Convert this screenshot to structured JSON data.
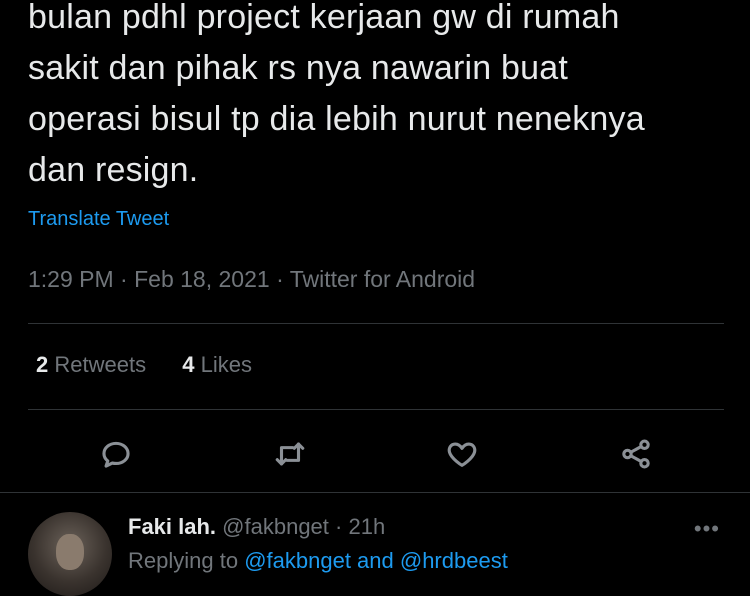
{
  "tweet": {
    "lines": [
      "bulan pdhl project kerjaan gw di rumah",
      "sakit dan pihak rs nya nawarin buat",
      "operasi bisul tp dia lebih nurut neneknya",
      "dan resign."
    ],
    "translate_label": "Translate Tweet",
    "time": "1:29 PM",
    "date": "Feb 18, 2021",
    "source": "Twitter for Android",
    "retweets_count": "2",
    "retweets_label": "Retweets",
    "likes_count": "4",
    "likes_label": "Likes"
  },
  "actions": {
    "reply_icon": "reply-icon",
    "retweet_icon": "retweet-icon",
    "like_icon": "heart-icon",
    "share_icon": "share-icon"
  },
  "reply": {
    "name": "Faki lah.",
    "handle": "@fakbnget",
    "time": "21h",
    "replying_prefix": "Replying to",
    "replying_to": "@fakbnget and @hrdbeest",
    "more": "•••"
  },
  "colors": {
    "background": "#000000",
    "text": "#e7e9ea",
    "muted": "#71767b",
    "link": "#1d9bf0",
    "divider": "#2f3336"
  }
}
